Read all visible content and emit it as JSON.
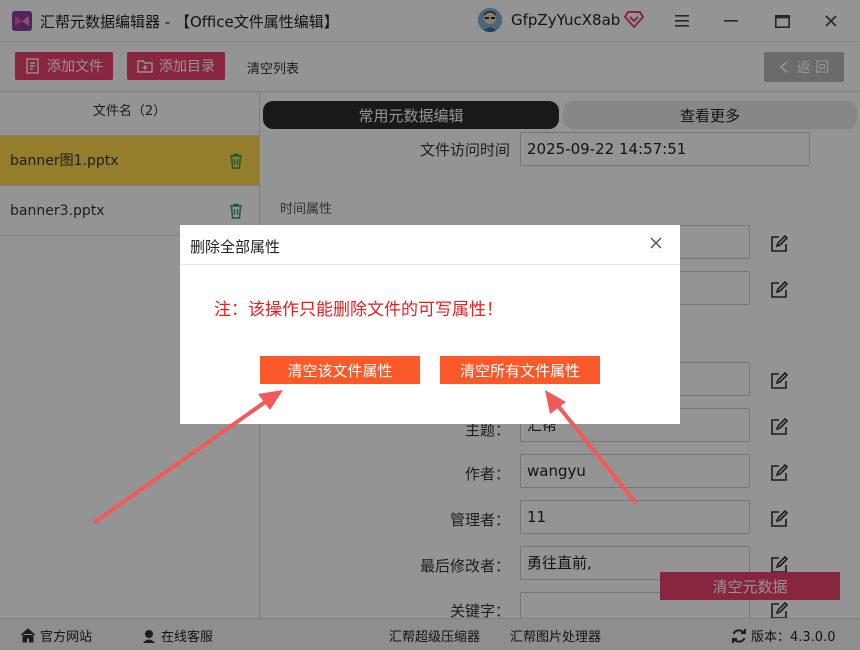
{
  "window": {
    "title": "汇帮元数据编辑器 - 【Office文件属性编辑】",
    "username": "GfpZyYucX8ab"
  },
  "toolbar": {
    "add_file": "添加文件",
    "add_folder": "添加目录",
    "clear_list": "清空列表",
    "back": "返 回"
  },
  "file_list": {
    "header": "文件名（2）",
    "files": [
      {
        "name": "banner图1.pptx",
        "selected": true
      },
      {
        "name": "banner3.pptx",
        "selected": false
      }
    ]
  },
  "tabs": {
    "common": "常用元数据编辑",
    "more": "查看更多"
  },
  "fields": {
    "access_time_label": "文件访问时间",
    "access_time_value": "2025-09-22 14:57:51",
    "section_time": "时间属性",
    "subject_label": "主题：",
    "subject_value": "汇帮",
    "author_label": "作者：",
    "author_value": "wangyu",
    "manager_label": "管理者：",
    "manager_value": "11",
    "last_modifier_label": "最后修改者：",
    "last_modifier_value": "勇往直前,",
    "keywords_label": "关键字："
  },
  "clear_metadata": "清空元数据",
  "modal": {
    "title": "删除全部属性",
    "note": "注：该操作只能删除文件的可写属性！",
    "clear_this": "清空该文件属性",
    "clear_all": "清空所有文件属性"
  },
  "statusbar": {
    "website": "官方网站",
    "support": "在线客服",
    "compressor": "汇帮超级压缩器",
    "image_tool": "汇帮图片处理器",
    "version": "版本：4.3.0.0"
  },
  "colors": {
    "accent": "#e8436c",
    "selected_row": "#ffd94a",
    "modal_button": "#fa5a2a",
    "warning_text": "#e81e1e",
    "arrow": "#f05a5a"
  }
}
